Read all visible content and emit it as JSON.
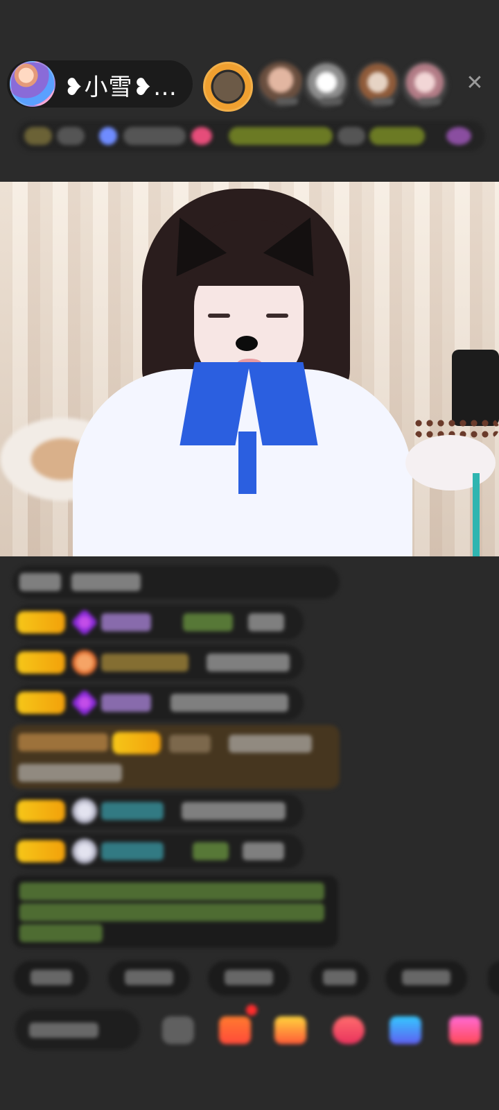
{
  "room": {
    "host_name": "❥小雪❥…",
    "close_symbol": "✕"
  },
  "colors": {
    "background": "#2a2a2a",
    "level_badge": "#f6c619",
    "special_message_bg": "#46361f",
    "green_text": "#8fd14f",
    "purple_name": "#b58be8",
    "cyan_name": "#3fb7c6",
    "gift_orange": "#ff7b2f",
    "gift_pink": "#ff4a56"
  },
  "icons": {
    "close": "close-icon",
    "emoji": "emoji-icon",
    "gifts": [
      "gift-box-icon",
      "treasure-icon",
      "heart-gift-icon",
      "car-gift-icon",
      "gift-pack-icon"
    ]
  }
}
